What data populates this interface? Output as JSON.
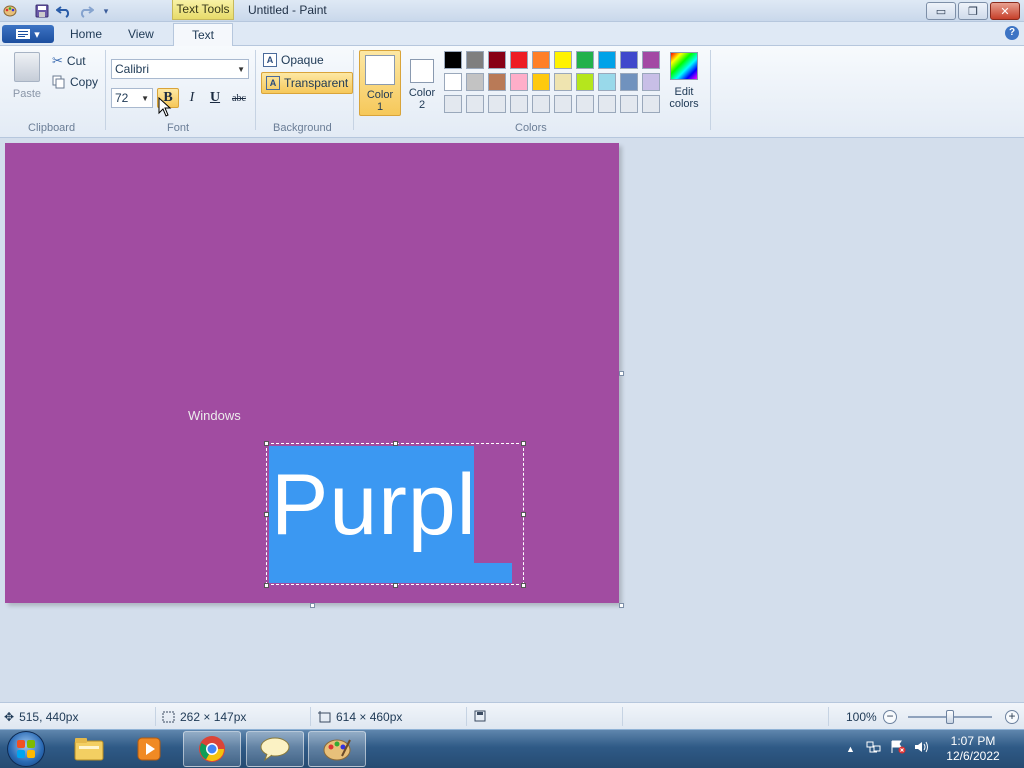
{
  "window": {
    "title": "Untitled - Paint",
    "contextual_tab": "Text Tools",
    "controls": {
      "minimize": "▭",
      "restore": "❐",
      "close": "✕"
    }
  },
  "quick_access": {
    "app_icon": "paint-icon",
    "save_icon": "save-icon",
    "undo_icon": "undo-icon",
    "redo_icon": "redo-icon",
    "customize_icon": "dropdown-icon"
  },
  "ribbon_tabs": {
    "file": "▾",
    "home": "Home",
    "view": "View",
    "text": "Text"
  },
  "clipboard": {
    "paste": "Paste",
    "cut": "Cut",
    "copy": "Copy",
    "group": "Clipboard"
  },
  "font": {
    "family": "Calibri",
    "size": "72",
    "bold": "B",
    "italic": "I",
    "underline": "U",
    "strike": "abc",
    "group": "Font"
  },
  "background": {
    "opaque": "Opaque",
    "transparent": "Transparent",
    "group": "Background"
  },
  "colors": {
    "color1_label": "Color",
    "color1_num": "1",
    "color2_label": "Color",
    "color2_num": "2",
    "edit_label": "Edit",
    "edit_label2": "colors",
    "group": "Colors",
    "color1": "#ffffff",
    "color2": "#ffffff",
    "palette_row1": [
      "#000000",
      "#7f7f7f",
      "#880015",
      "#ed1c24",
      "#ff7f27",
      "#fff200",
      "#22b14c",
      "#00a2e8",
      "#3f48cc",
      "#a349a4"
    ],
    "palette_row2": [
      "#ffffff",
      "#c3c3c3",
      "#b97a57",
      "#ffaec9",
      "#ffc90e",
      "#efe4b0",
      "#b5e61d",
      "#99d9ea",
      "#7092be",
      "#c8bfe7"
    ],
    "palette_row3": [
      "#e3e8ef",
      "#e3e8ef",
      "#e3e8ef",
      "#e3e8ef",
      "#e3e8ef",
      "#e3e8ef",
      "#e3e8ef",
      "#e3e8ef",
      "#e3e8ef",
      "#e3e8ef"
    ]
  },
  "canvas": {
    "background": "#a14ca1",
    "label_text": "Windows",
    "typed_text": "Purpl",
    "highlight": "#3b98f2"
  },
  "status": {
    "cursor_pos": "515, 440px",
    "selection_size": "262 × 147px",
    "image_size": "614 × 460px",
    "zoom": "100%",
    "zoom_out": "−",
    "zoom_in": "+"
  },
  "taskbar": {
    "apps": [
      "explorer-icon",
      "media-player-icon",
      "chrome-icon",
      "speech-icon",
      "paint-icon"
    ],
    "time": "1:07 PM",
    "date": "12/6/2022"
  }
}
